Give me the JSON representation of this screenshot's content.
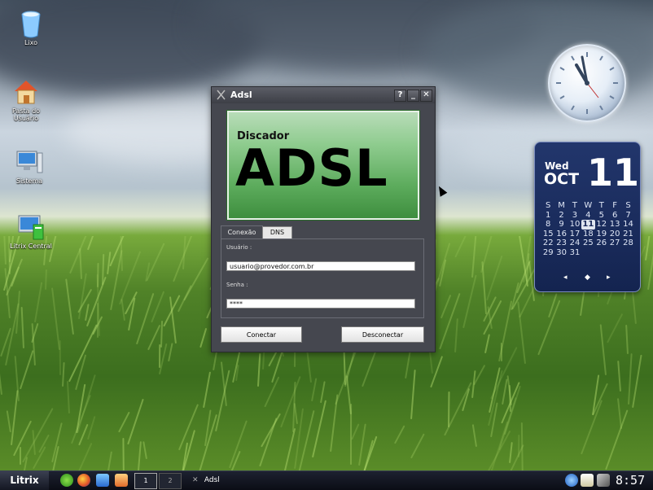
{
  "desktop": {
    "icons": [
      {
        "label": "Lixo"
      },
      {
        "label": "Pasta do Usuário"
      },
      {
        "label": "Sistema"
      },
      {
        "label": "Litrix Central"
      }
    ]
  },
  "window": {
    "title": "Adsl",
    "buttons": {
      "help": "?",
      "minimize": "_",
      "close": "✕"
    },
    "banner": {
      "small": "Discador",
      "big": "ADSL"
    },
    "tabs": [
      {
        "label": "Conexão"
      },
      {
        "label": "DNS"
      }
    ],
    "user_label": "Usuário :",
    "user_value": "usuario@provedor.com.br",
    "password_label": "Senha :",
    "password_value": "****",
    "connect_label": "Conectar",
    "disconnect_label": "Desconectar"
  },
  "calendar": {
    "weekday": "Wed",
    "month": "OCT",
    "day": "11",
    "headers": [
      "S",
      "M",
      "T",
      "W",
      "T",
      "F",
      "S"
    ],
    "weeks": [
      [
        "1",
        "2",
        "3",
        "4",
        "5",
        "6",
        "7"
      ],
      [
        "8",
        "9",
        "10",
        "11",
        "12",
        "13",
        "14"
      ],
      [
        "15",
        "16",
        "17",
        "18",
        "19",
        "20",
        "21"
      ],
      [
        "22",
        "23",
        "24",
        "25",
        "26",
        "27",
        "28"
      ],
      [
        "29",
        "30",
        "31",
        "",
        "",
        "",
        ""
      ]
    ],
    "nav": [
      "◂",
      "◆",
      "▸"
    ]
  },
  "taskbar": {
    "start_label": "Litrix",
    "pager": [
      "1",
      "2"
    ],
    "task_label": "Adsl",
    "clock": "8:57"
  },
  "colors": {
    "window_bg": "#45474f",
    "calendar_bg": "#1d2f5e",
    "banner_green": "#5cab5c"
  }
}
